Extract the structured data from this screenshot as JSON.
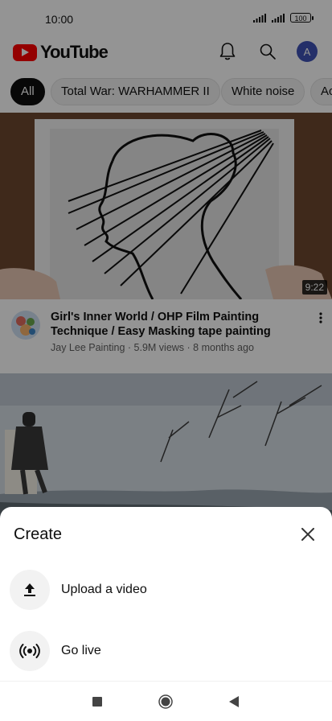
{
  "status_bar": {
    "time": "10:00",
    "battery": "100"
  },
  "header": {
    "logo_text": "YouTube",
    "notifications_icon": "bell-icon",
    "search_icon": "search-icon",
    "avatar_letter": "A"
  },
  "chips": [
    {
      "label": "All",
      "active": true
    },
    {
      "label": "Total War: WARHAMMER II"
    },
    {
      "label": "White noise"
    },
    {
      "label": "Ac"
    }
  ],
  "video": {
    "duration": "9:22",
    "title": "Girl's Inner World / OHP Film  Painting Technique / Easy Masking tape painting",
    "channel": "Jay Lee Painting",
    "views": "5.9M views",
    "age": "8 months ago",
    "meta_line": "Jay Lee Painting · 5.9M views · 8 months ago"
  },
  "create_sheet": {
    "title": "Create",
    "items": [
      {
        "label": "Upload a video",
        "icon": "upload-icon"
      },
      {
        "label": "Go live",
        "icon": "live-broadcast-icon"
      }
    ]
  },
  "nav_bar": {
    "buttons": [
      "recents-icon",
      "home-icon",
      "back-icon"
    ]
  },
  "colors": {
    "brand_red": "#ff0000",
    "avatar_bg": "#3f51b5",
    "scrim": "rgba(0,0,0,0.42)"
  }
}
